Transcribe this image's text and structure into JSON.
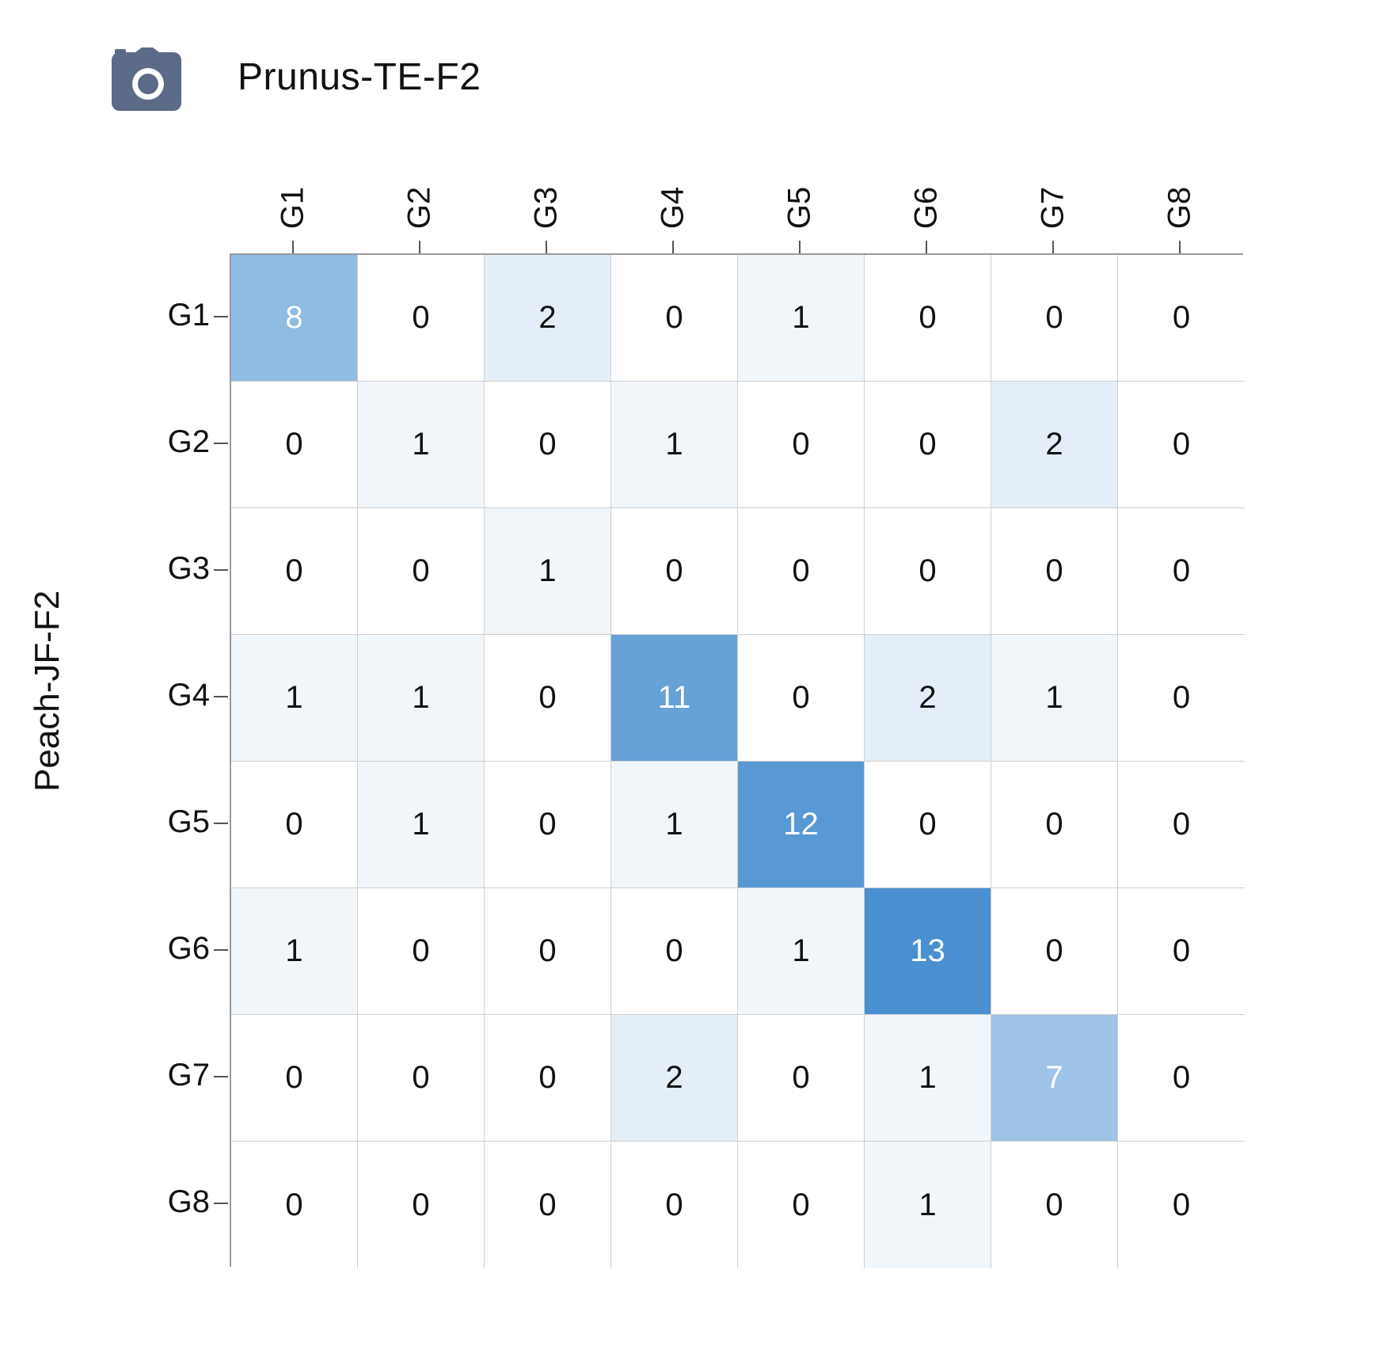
{
  "chart_data": {
    "type": "heatmap",
    "title": "Prunus-TE-F2",
    "ylabel": "Peach-JF-F2",
    "x_categories": [
      "G1",
      "G2",
      "G3",
      "G4",
      "G5",
      "G6",
      "G7",
      "G8"
    ],
    "y_categories": [
      "G1",
      "G2",
      "G3",
      "G4",
      "G5",
      "G6",
      "G7",
      "G8"
    ],
    "values": [
      [
        8,
        0,
        2,
        0,
        1,
        0,
        0,
        0
      ],
      [
        0,
        1,
        0,
        1,
        0,
        0,
        2,
        0
      ],
      [
        0,
        0,
        1,
        0,
        0,
        0,
        0,
        0
      ],
      [
        1,
        1,
        0,
        11,
        0,
        2,
        1,
        0
      ],
      [
        0,
        1,
        0,
        1,
        12,
        0,
        0,
        0
      ],
      [
        1,
        0,
        0,
        0,
        1,
        13,
        0,
        0
      ],
      [
        0,
        0,
        0,
        2,
        0,
        1,
        7,
        0
      ],
      [
        0,
        0,
        0,
        0,
        0,
        1,
        0,
        0
      ]
    ],
    "value_range": [
      0,
      13
    ],
    "palette": {
      "low": "#ffffff",
      "high": "#4a90d0"
    }
  },
  "icons": {
    "camera": "camera-icon"
  }
}
